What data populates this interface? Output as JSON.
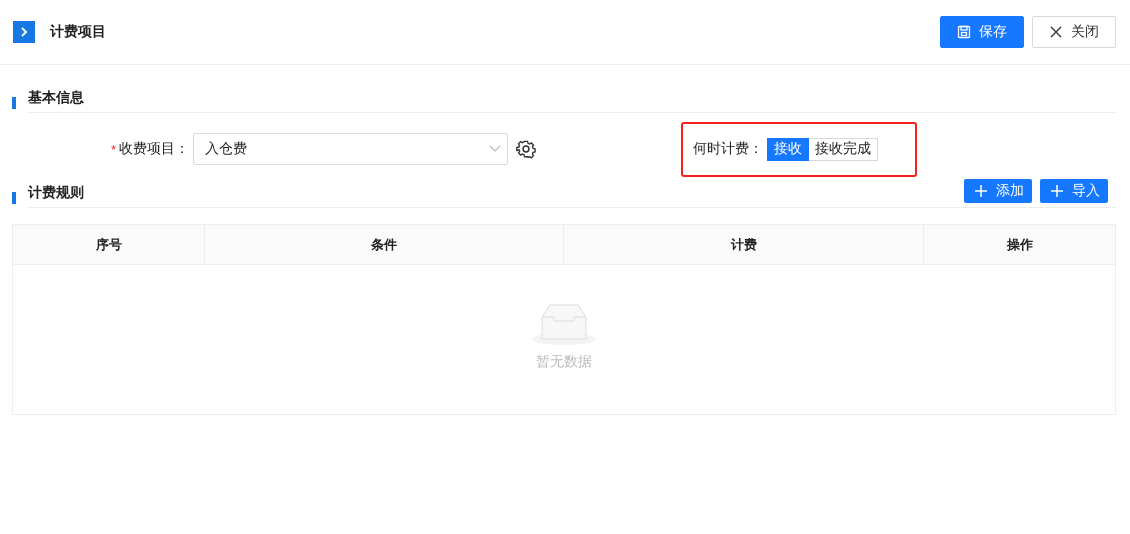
{
  "header": {
    "title": "计费项目",
    "buttons": [
      {
        "label": "保存",
        "kind": "primary"
      },
      {
        "label": "关闭",
        "kind": "default"
      }
    ]
  },
  "basic_info": {
    "title": "基本信息",
    "fee_item": {
      "required_mark": "*",
      "label": "收费项目：",
      "value": "入仓费"
    },
    "charge_timing": {
      "label": "何时计费：",
      "highlighted": true,
      "options": [
        {
          "label": "接收",
          "selected": true
        },
        {
          "label": "接收完成",
          "selected": false
        }
      ]
    }
  },
  "rules": {
    "title": "计费规则",
    "buttons": [
      {
        "label": "添加"
      },
      {
        "label": "导入"
      }
    ],
    "table": {
      "columns": [
        "序号",
        "条件",
        "计费",
        "操作"
      ],
      "empty_text": "暂无数据"
    }
  }
}
